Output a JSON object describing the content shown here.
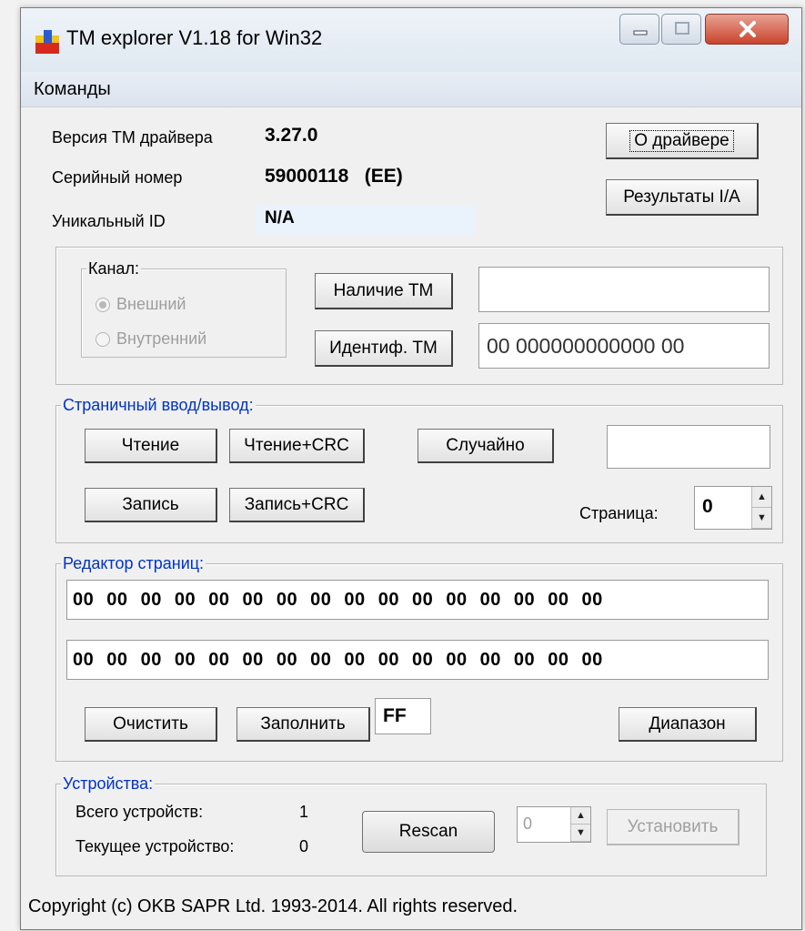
{
  "window": {
    "title": "TM explorer V1.18 for Win32"
  },
  "menu": {
    "commands": "Команды"
  },
  "info": {
    "driver_version_label": "Версия  TM драйвера",
    "driver_version_value": "3.27.0",
    "serial_label": "Серийный номер",
    "serial_value": "59000118   (EE)",
    "unique_id_label": "Уникальный ID",
    "unique_id_value": "N/A"
  },
  "buttons": {
    "about_driver": "О драйвере",
    "ia_results": "Результаты I/A",
    "tm_presence": "Наличие TM",
    "tm_identify": "Идентиф. TM",
    "read": "Чтение",
    "read_crc": "Чтение+CRC",
    "random": "Случайно",
    "write": "Запись",
    "write_crc": "Запись+CRC",
    "clear": "Очистить",
    "fill": "Заполнить",
    "range": "Диапазон",
    "rescan": "Rescan",
    "set": "Установить"
  },
  "channel": {
    "legend": "Канал:",
    "external": "Внешний",
    "internal": "Внутренний",
    "selected": "external"
  },
  "tm_fields": {
    "presence_value": "",
    "id_value": "00 000000000000 00"
  },
  "page_io": {
    "legend": "Страничный ввод/вывод:",
    "random_value": "",
    "page_label": "Страница:",
    "page_value": "0"
  },
  "page_editor": {
    "legend": "Редактор страниц:",
    "row1": "00 00 00 00 00 00 00 00 00 00 00 00 00 00 00 00",
    "row2": "00 00 00 00 00 00 00 00 00 00 00 00 00 00 00 00",
    "fill_value": "FF"
  },
  "devices": {
    "legend": "Устройства:",
    "total_label": "Всего устройств:",
    "total_value": "1",
    "current_label": "Текущее устройство:",
    "current_value": "0",
    "selector_value": "0"
  },
  "footer": {
    "copyright": "Copyright (c) OKB SAPR Ltd. 1993-2014. All rights reserved."
  }
}
